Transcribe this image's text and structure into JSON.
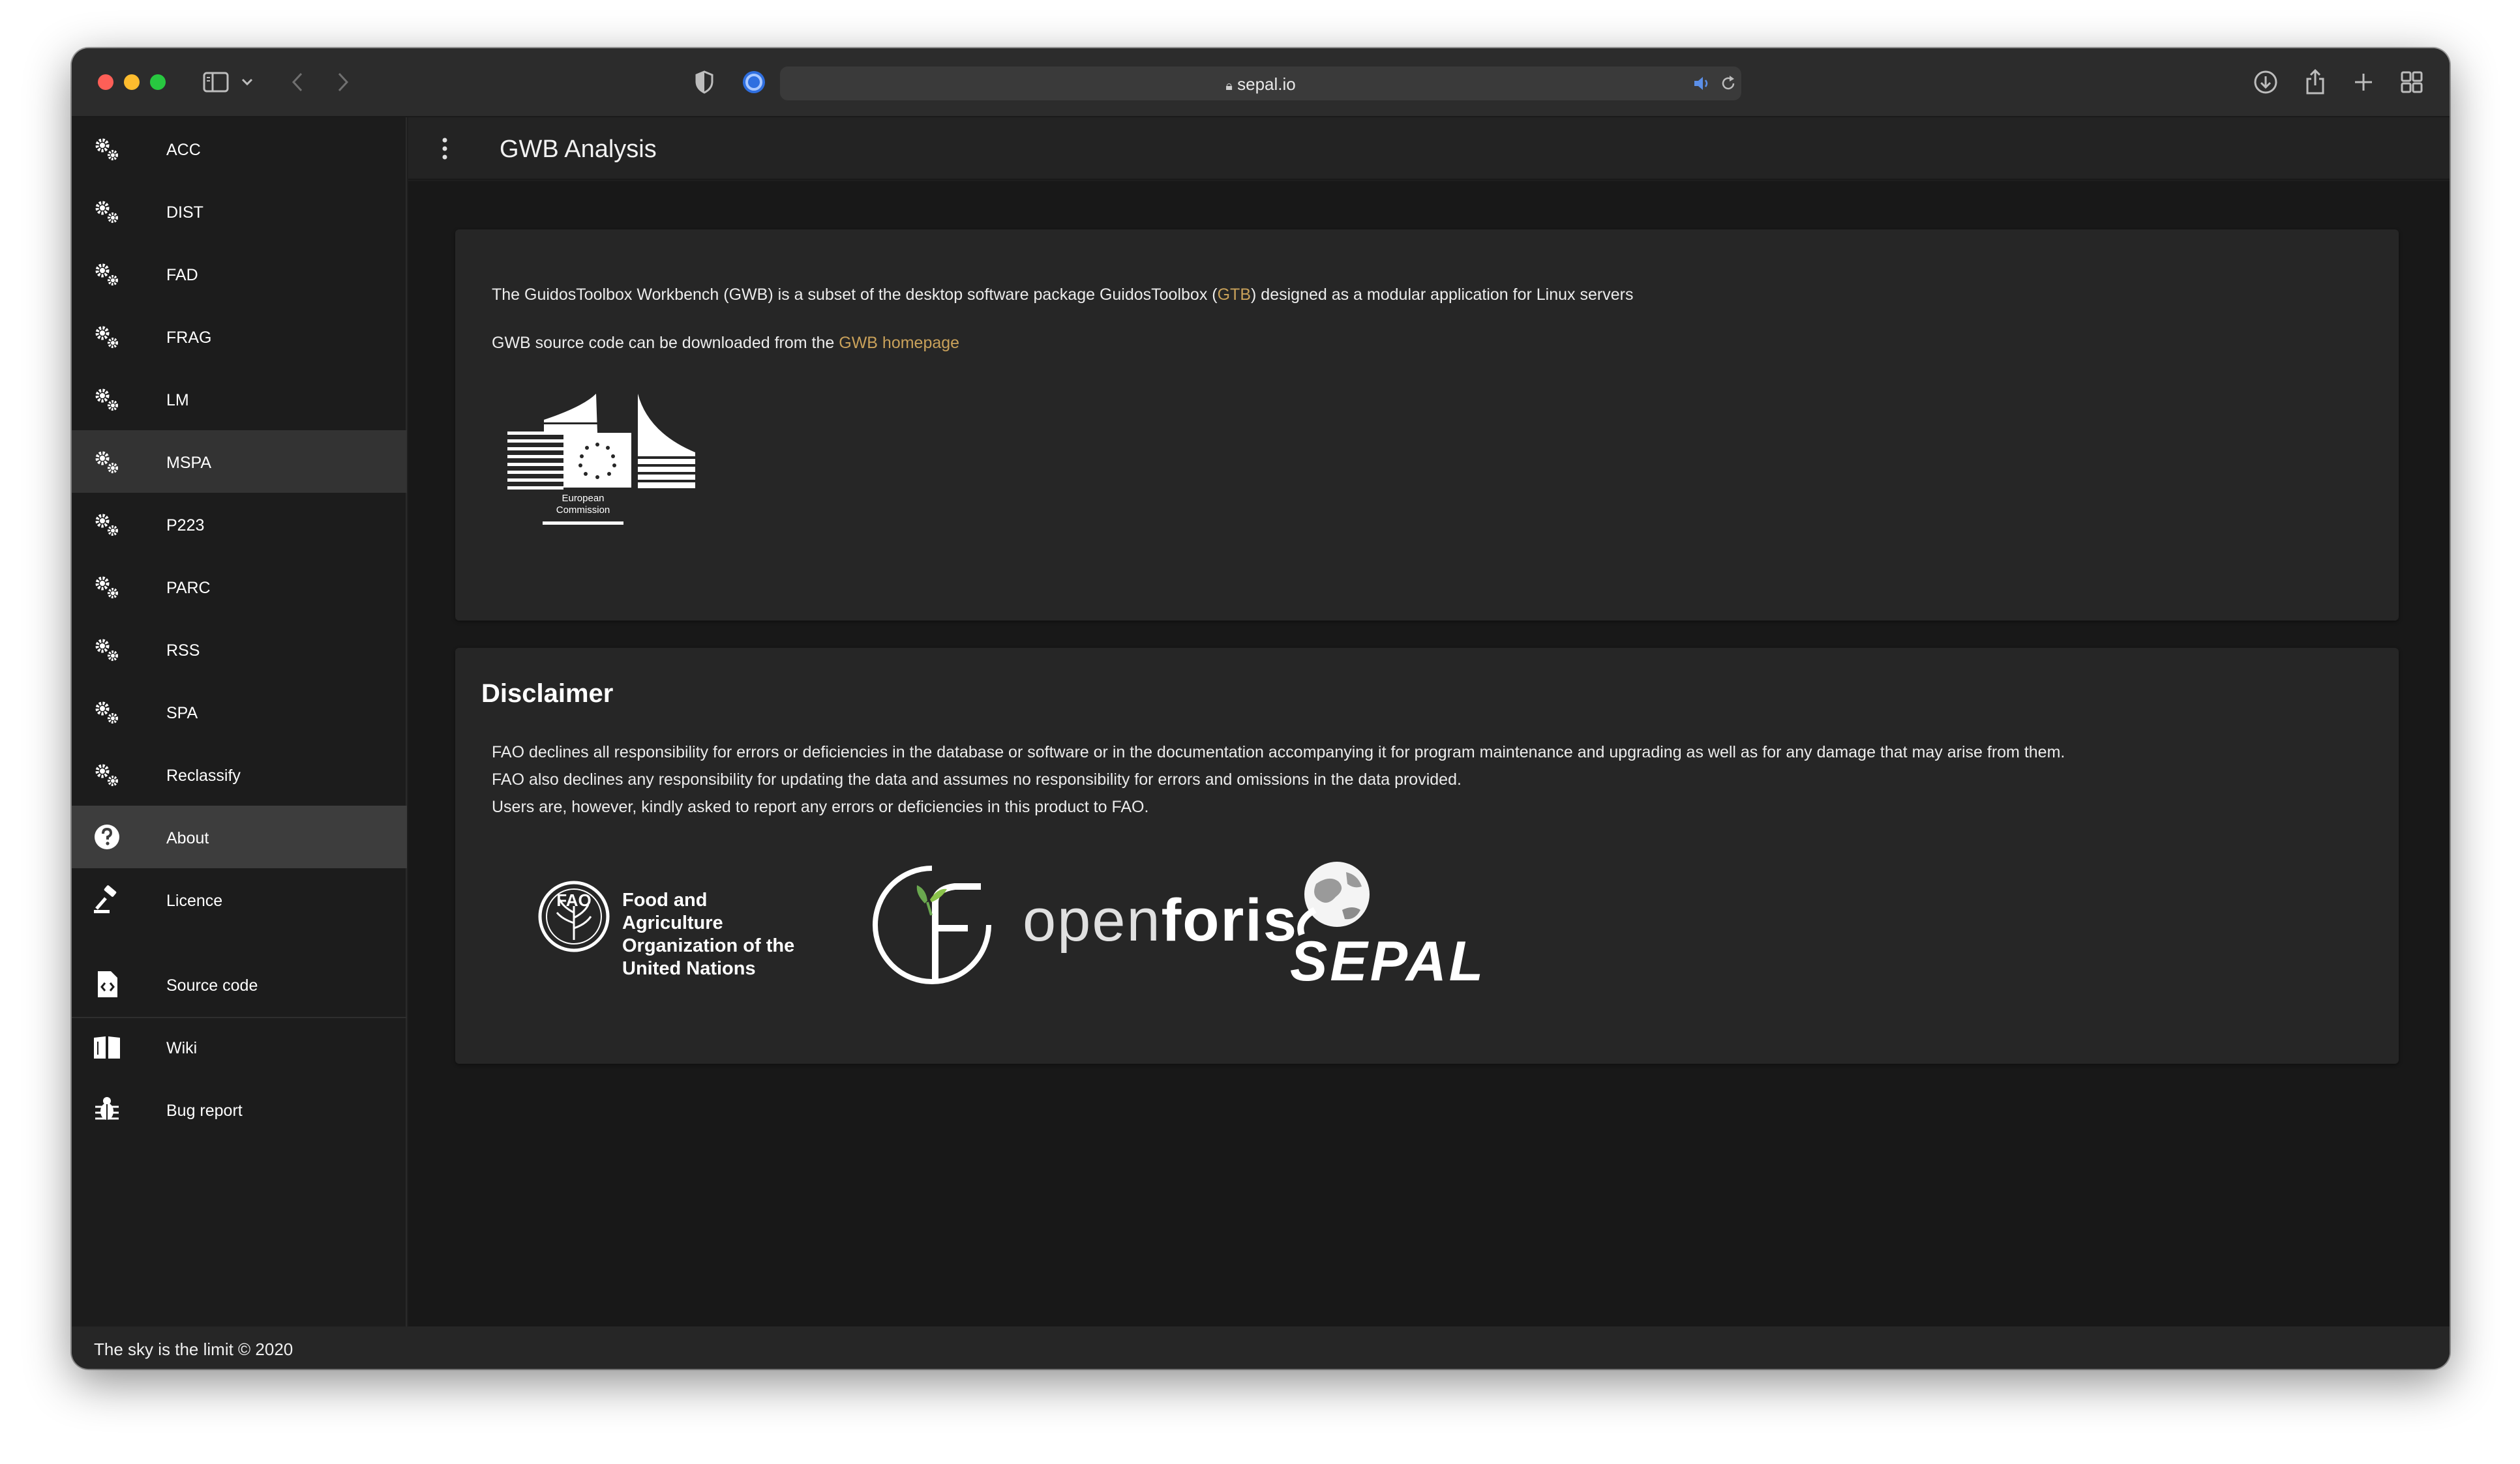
{
  "browser": {
    "url": "sepal.io"
  },
  "app": {
    "title": "GWB Analysis"
  },
  "sidebar": {
    "items": [
      {
        "label": "ACC",
        "icon": "gears-icon"
      },
      {
        "label": "DIST",
        "icon": "gears-icon"
      },
      {
        "label": "FAD",
        "icon": "gears-icon"
      },
      {
        "label": "FRAG",
        "icon": "gears-icon"
      },
      {
        "label": "LM",
        "icon": "gears-icon"
      },
      {
        "label": "MSPA",
        "icon": "gears-icon"
      },
      {
        "label": "P223",
        "icon": "gears-icon"
      },
      {
        "label": "PARC",
        "icon": "gears-icon"
      },
      {
        "label": "RSS",
        "icon": "gears-icon"
      },
      {
        "label": "SPA",
        "icon": "gears-icon"
      },
      {
        "label": "Reclassify",
        "icon": "gears-icon"
      },
      {
        "label": "About",
        "icon": "question-circle-icon"
      },
      {
        "label": "Licence",
        "icon": "gavel-icon"
      }
    ],
    "links": [
      {
        "label": "Source code",
        "icon": "file-code-icon"
      },
      {
        "label": "Wiki",
        "icon": "book-icon"
      },
      {
        "label": "Bug report",
        "icon": "bug-icon"
      }
    ]
  },
  "about": {
    "intro_before": "The GuidosToolbox Workbench (GWB) is a subset of the desktop software package GuidosToolbox (",
    "intro_link": "GTB",
    "intro_after": ") designed as a modular application for Linux servers",
    "source_before": "GWB source code can be downloaded from the ",
    "source_link": "GWB homepage",
    "ec_logo_line1": "European",
    "ec_logo_line2": "Commission"
  },
  "disclaimer": {
    "title": "Disclaimer",
    "lines": [
      "FAO declines all responsibility for errors or deficiencies in the database or software or in the documentation accompanying it for program maintenance and upgrading as well as for any damage that may arise from them.",
      "FAO also declines any responsibility for updating the data and assumes no responsibility for errors and omissions in the data provided.",
      "Users are, however, kindly asked to report any errors or deficiencies in this product to FAO."
    ],
    "fao_line1": "Food and Agriculture",
    "fao_line2": "Organization of the",
    "fao_line3": "United Nations",
    "fao_emblem_text": "FAO",
    "openforis_part1": "open",
    "openforis_part2": "foris",
    "sepal_text": "SEPAL"
  },
  "footer": {
    "text": "The sky is the limit © 2020"
  },
  "colors": {
    "link": "#c9a15a",
    "sidebar_active": "#3d3d3d"
  }
}
